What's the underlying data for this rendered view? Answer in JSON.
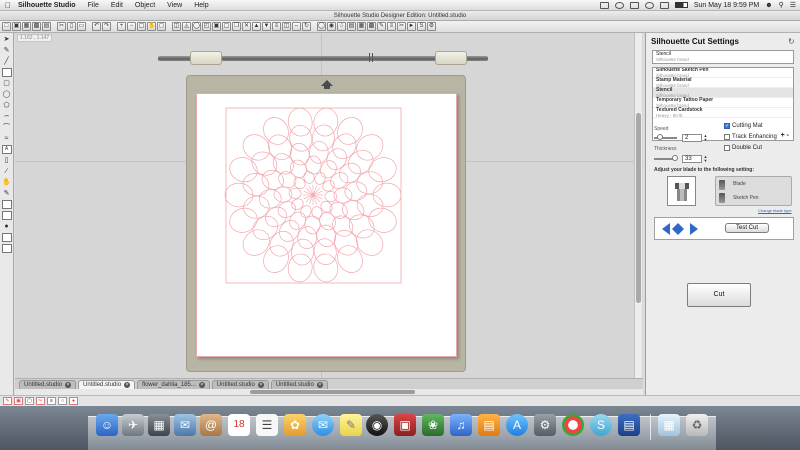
{
  "menubar": {
    "app_name": "Silhouette Studio",
    "menus": [
      "File",
      "Edit",
      "Object",
      "View",
      "Help"
    ],
    "clock": "Sun May 18  9:59 PM"
  },
  "window": {
    "title": "Silhouette Studio Designer Edition: Untitled.studio"
  },
  "ruler": {
    "readout": "1.162 , 1.147"
  },
  "tabs": [
    {
      "label": "Untitled.studio",
      "active": false
    },
    {
      "label": "Untitled.studio",
      "active": true
    },
    {
      "label": "flower_dahlia_185...",
      "active": false
    },
    {
      "label": "Untitled.studio",
      "active": false
    },
    {
      "label": "Untitled.studio",
      "active": false
    }
  ],
  "panel": {
    "title": "Silhouette Cut Settings",
    "current_material": {
      "name": "Stencil",
      "brand": "Silhouette brand"
    },
    "materials": [
      {
        "name": "Silhouette Sketch Pen",
        "brand": "Silhouette brand"
      },
      {
        "name": "Stamp Material",
        "brand": "Silhouette brand"
      },
      {
        "name": "Stencil",
        "brand": "Silhouette brand",
        "selected": true
      },
      {
        "name": "Temporary Tattoo Paper",
        "brand": "Silhouette brand"
      },
      {
        "name": "Textured Cardstock",
        "brand": "Heavy - 80 lb"
      }
    ],
    "list_buttons": "+ -",
    "speed_label": "Speed",
    "speed_value": "2",
    "thickness_label": "Thickness",
    "thickness_value": "33",
    "options": {
      "cutting_mat": "Cutting Mat",
      "track_enhancing": "Track Enhancing",
      "double_cut": "Double Cut"
    },
    "blade_instruction": "Adjust your blade to the following setting:",
    "blade_tool": "Blade",
    "sketch_tool": "Sketch Pen",
    "change_link": "Change blade type",
    "test_cut": "Test Cut",
    "cut": "Cut"
  },
  "colors": {
    "design_stroke": "#f2a7ab",
    "mat": "#b8b5a4",
    "accent": "#3b7ad9"
  }
}
